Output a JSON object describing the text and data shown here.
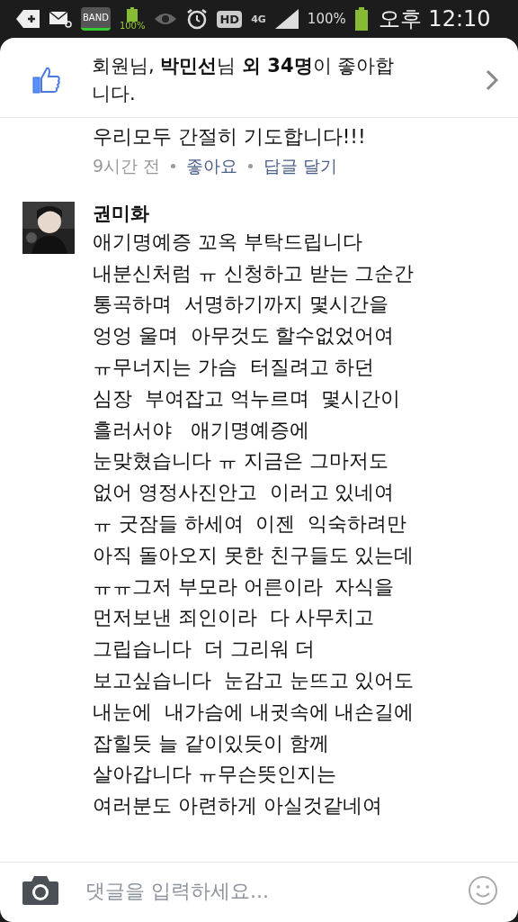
{
  "status_bar": {
    "band_label": "BAND",
    "battery_small": "100%",
    "hd_label": "HD",
    "network": "4G",
    "battery": "100%",
    "time": "오후 12:10"
  },
  "likes": {
    "text": "회원님, **박민선**님 **외 34명**이 좋아합니다."
  },
  "comments": [
    {
      "kind": "partial",
      "body_lines": [
        "우리모두 간절히 기도합니다!!!"
      ],
      "time": "9시간 전",
      "actions": [
        "좋아요",
        "답글 달기"
      ]
    },
    {
      "kind": "full",
      "author": "권미화",
      "body_lines": [
        "애기명예증 꼬옥 부탁드립니다",
        "내분신처럼 ㅠ 신청하고 받는 그순간",
        "통곡하며  서명하기까지 몇시간을",
        "엉엉 울며  아무것도 할수없었어여",
        "ㅠ무너지는 가슴  터질려고 하던",
        "심장  부여잡고 억누르며  몇시간이",
        "흘러서야   애기명예증에",
        "눈맞혔습니다 ㅠ 지금은 그마저도",
        "없어 영정사진안고  이러고 있네여",
        "ㅠ 굿잠들 하세여  이젠  익숙하려만",
        "아직 돌아오지 못한 친구들도 있는데",
        "ㅠㅠ그저 부모라 어른이라  자식을",
        "먼저보낸 죄인이라  다 사무치고",
        "그립습니다  더 그리워 더",
        "보고싶습니다  눈감고 눈뜨고 있어도",
        "내눈에  내가슴에 내귓속에 내손길에",
        "잡힐듯 늘 같이있듯이 함께",
        "살아갑니다 ㅠ무슨뜻인지는",
        "여러분도 아련하게 아실것같네여"
      ]
    }
  ],
  "composer": {
    "placeholder": "댓글을 입력하세요..."
  }
}
